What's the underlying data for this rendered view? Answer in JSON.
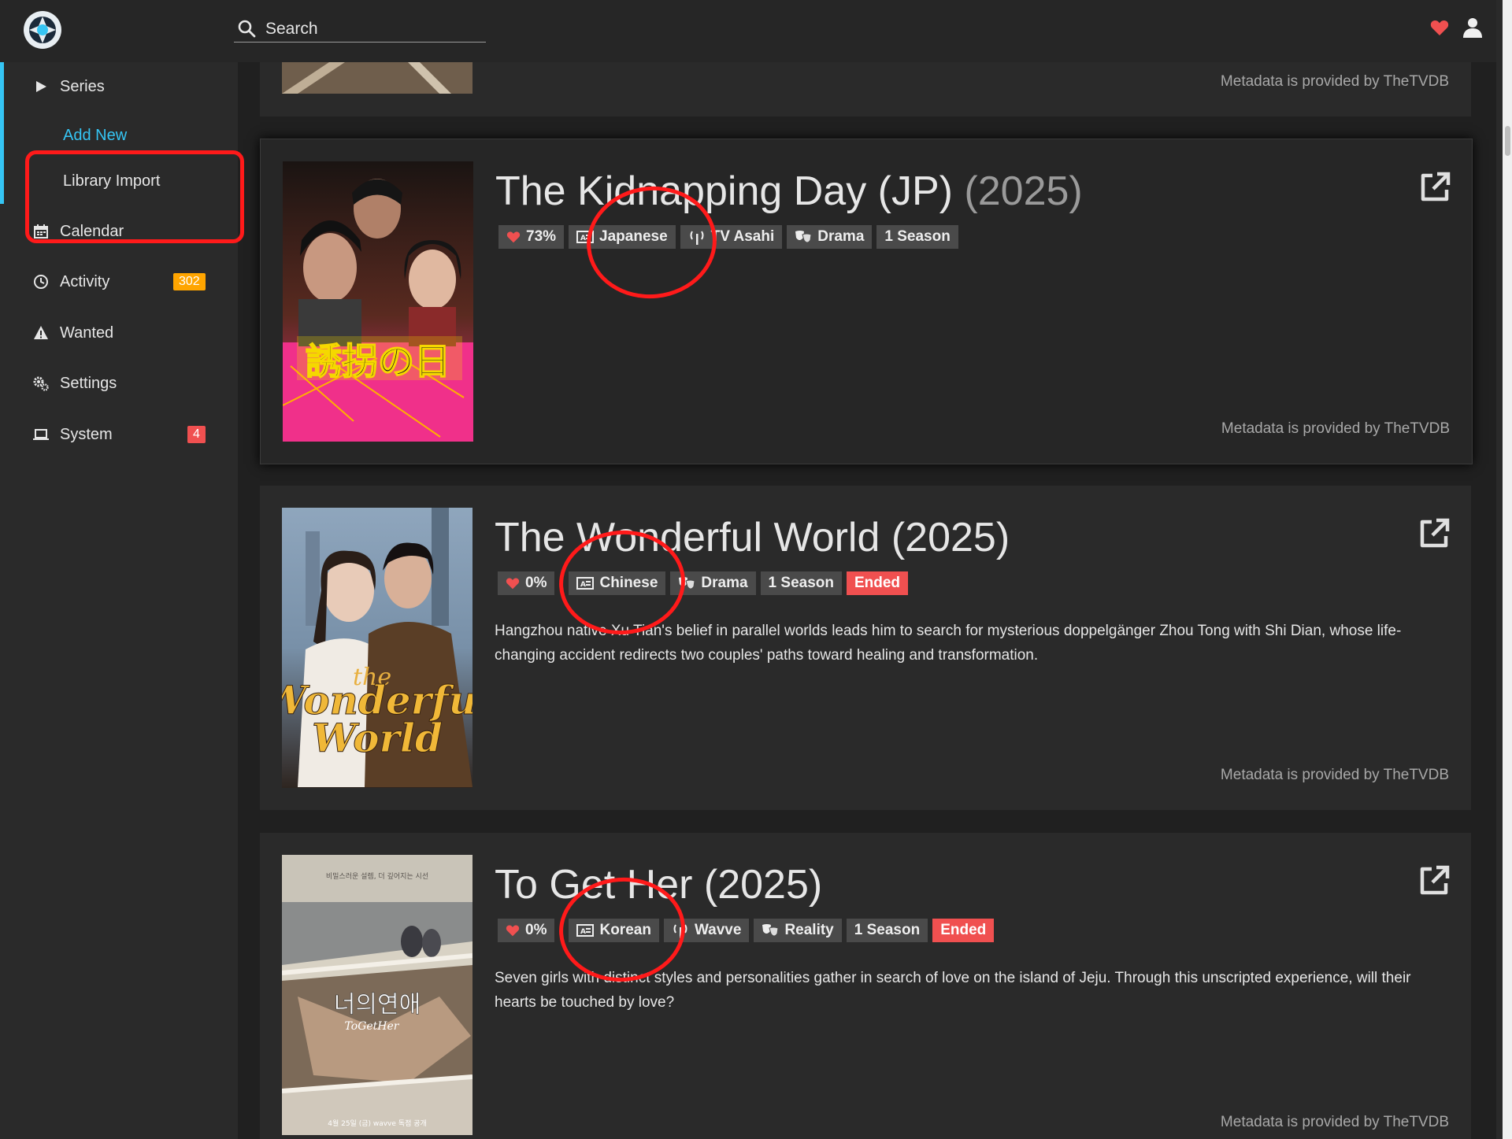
{
  "header": {
    "search_placeholder": "Search"
  },
  "sidebar": {
    "items": [
      {
        "label": "Series",
        "icon": "play-icon"
      },
      {
        "label": "Calendar",
        "icon": "calendar-icon"
      },
      {
        "label": "Activity",
        "icon": "clock-icon",
        "badge": "302",
        "badge_color": "#ffa500"
      },
      {
        "label": "Wanted",
        "icon": "warning-icon"
      },
      {
        "label": "Settings",
        "icon": "gears-icon"
      },
      {
        "label": "System",
        "icon": "laptop-icon",
        "badge": "4",
        "badge_color": "#f05050"
      }
    ],
    "sub_items": [
      {
        "label": "Add New",
        "active": true
      },
      {
        "label": "Library Import",
        "active": false
      }
    ]
  },
  "metadata_note": "Metadata is provided by TheTVDB",
  "series": [
    {
      "title": "The Kidnapping Day (JP)",
      "year": "(2025)",
      "rating": "73%",
      "language": "Japanese",
      "network": "TV Asahi",
      "genre": "Drama",
      "seasons": "1 Season",
      "status": "",
      "overview": "",
      "poster_text": "誘拐の日"
    },
    {
      "title": "The Wonderful World",
      "year": "(2025)",
      "rating": "0%",
      "language": "Chinese",
      "network": "",
      "genre": "Drama",
      "seasons": "1 Season",
      "status": "Ended",
      "overview": "Hangzhou native Xu Tian's belief in parallel worlds leads him to search for mysterious doppelgänger Zhou Tong with Shi Dian, whose life-changing accident redirects two couples' paths toward healing and transformation.",
      "poster_text_1": "the",
      "poster_text_2": "Wonderful",
      "poster_text_3": "World"
    },
    {
      "title": "To Get Her",
      "year": "(2025)",
      "rating": "0%",
      "language": "Korean",
      "network": "Wavve",
      "genre": "Reality",
      "seasons": "1 Season",
      "status": "Ended",
      "overview": "Seven girls with distinct styles and personalities gather in search of love on the island of Jeju. Through this unscripted experience, will their hearts be touched by love?",
      "poster_text_top": "비밀스러운 설렘, 더 깊어지는 시선",
      "poster_text": "너의연애",
      "poster_text_sub": "ToGetHer",
      "poster_text_bottom": "4월 25일 (금) wavve 독점 공개"
    }
  ],
  "colors": {
    "accent": "#35c5f4",
    "heart": "#f05050",
    "ended": "#f05050",
    "annotation": "#ff1a1a"
  }
}
